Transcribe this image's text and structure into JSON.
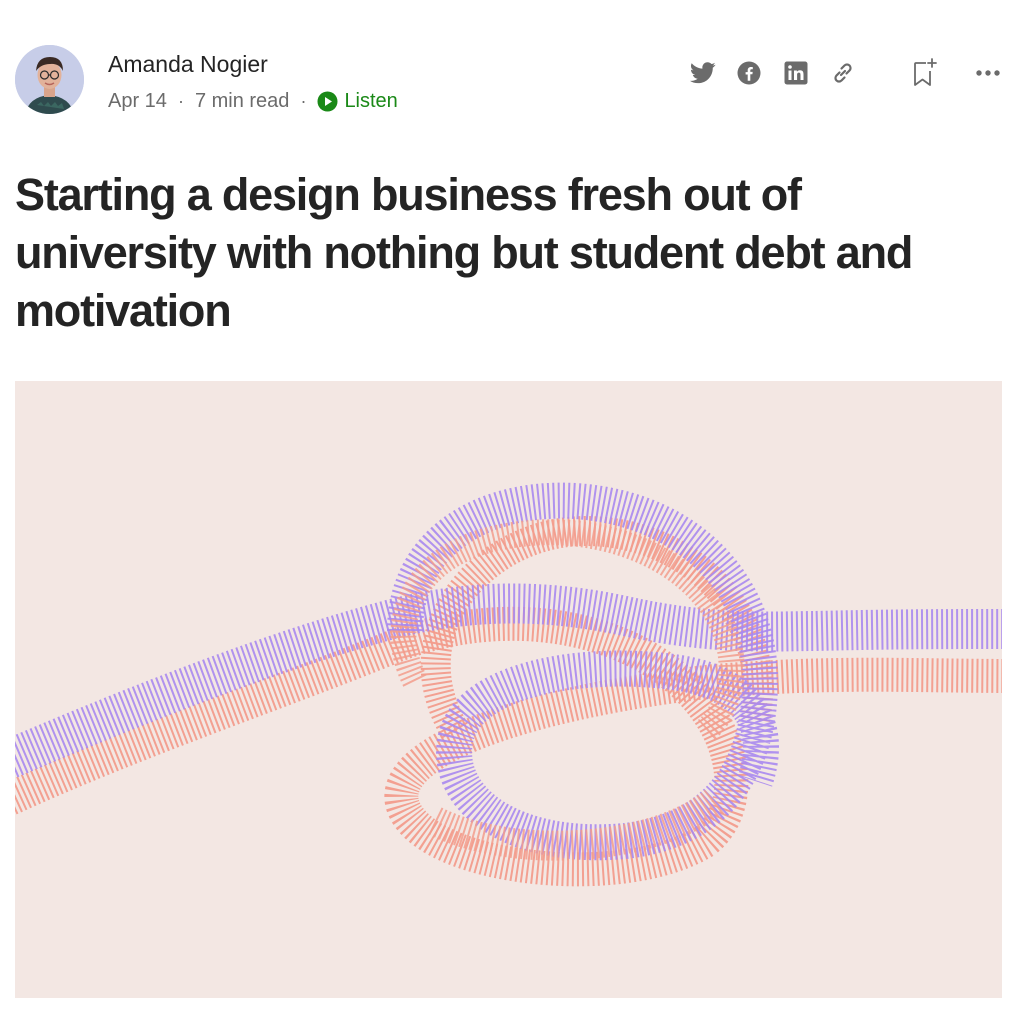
{
  "author": {
    "name": "Amanda Nogier",
    "avatar": "author-portrait"
  },
  "meta": {
    "date": "Apr 14",
    "separator": "·",
    "read_time": "7 min read",
    "listen_label": "Listen"
  },
  "actions": {
    "icons": [
      "twitter-icon",
      "facebook-icon",
      "linkedin-icon",
      "copy-link-icon",
      "bookmark-add-icon",
      "more-options-icon"
    ]
  },
  "article": {
    "title": "Starting a design business fresh out of university with nothing but student debt and motivation",
    "hero_image": "knotted-rope-illustration"
  },
  "colors": {
    "text": "#242424",
    "meta": "#6b6b6b",
    "listen_green": "#1a8917",
    "icon_gray": "#6b6b6b",
    "hero_bg": "#f3e7e3",
    "rope_purple": "#a888ee",
    "rope_salmon": "#f29c8c"
  }
}
